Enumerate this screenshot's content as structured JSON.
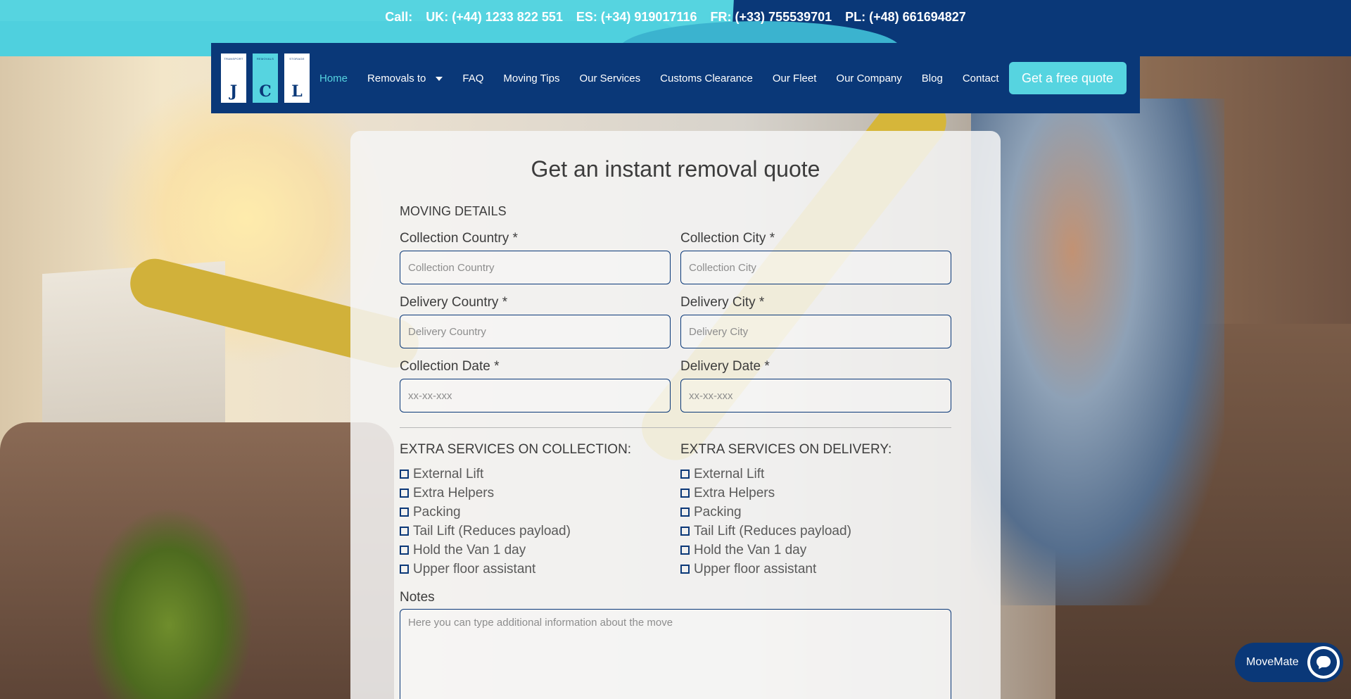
{
  "topbar": {
    "call_label": "Call:",
    "phones": [
      "UK: (+44) 1233 822 551",
      "ES: (+34) 919017116",
      "FR: (+33) 755539701",
      "PL: (+48) 661694827"
    ]
  },
  "logo": {
    "tiles": [
      {
        "small": "TRANSPORT",
        "letter": "J"
      },
      {
        "small": "REMOVALS",
        "letter": "C"
      },
      {
        "small": "STORAGE",
        "letter": "L"
      }
    ]
  },
  "nav": {
    "items": [
      "Home",
      "Removals to",
      "FAQ",
      "Moving Tips",
      "Our Services",
      "Customs Clearance",
      "Our Fleet",
      "Our Company",
      "Blog",
      "Contact"
    ],
    "cta": "Get a free quote"
  },
  "form": {
    "title": "Get an instant removal quote",
    "section": "MOVING DETAILS",
    "fields": {
      "collection_country": {
        "label": "Collection Country *",
        "placeholder": "Collection Country"
      },
      "collection_city": {
        "label": "Collection City *",
        "placeholder": "Collection City"
      },
      "delivery_country": {
        "label": "Delivery Country *",
        "placeholder": "Delivery Country"
      },
      "delivery_city": {
        "label": "Delivery City *",
        "placeholder": "Delivery City"
      },
      "collection_date": {
        "label": "Collection Date *",
        "placeholder": "xx-xx-xxx"
      },
      "delivery_date": {
        "label": "Delivery Date *",
        "placeholder": "xx-xx-xxx"
      }
    },
    "extras_collection": {
      "heading": "EXTRA SERVICES ON COLLECTION:",
      "options": [
        "External Lift",
        "Extra Helpers",
        "Packing",
        "Tail Lift (Reduces payload)",
        "Hold the Van 1 day",
        "Upper floor assistant"
      ]
    },
    "extras_delivery": {
      "heading": "EXTRA SERVICES ON DELIVERY:",
      "options": [
        "External Lift",
        "Extra Helpers",
        "Packing",
        "Tail Lift (Reduces payload)",
        "Hold the Van 1 day",
        "Upper floor assistant"
      ]
    },
    "notes": {
      "label": "Notes",
      "placeholder": "Here you can type additional information about the move"
    }
  },
  "chat": {
    "label": "MoveMate",
    "icon": "chat-bubble-icon"
  },
  "colors": {
    "navy": "#0a3878",
    "cyan": "#56d4e0"
  }
}
